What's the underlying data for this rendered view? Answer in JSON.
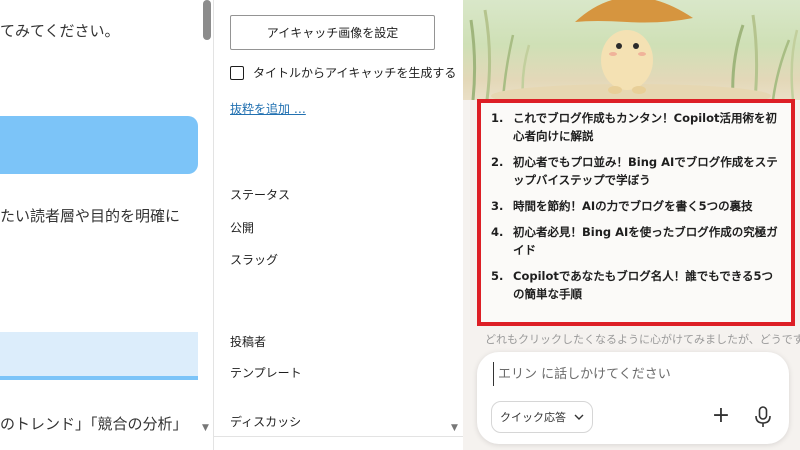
{
  "editor": {
    "line1": "てみてください。",
    "line2": "たい読者層や目的を明確に",
    "line3": "のトレンド」「競合の分析」"
  },
  "settings": {
    "featured_image_button": "アイキャッチ画像を設定",
    "generate_from_title_label": "タイトルからアイキャッチを生成する",
    "add_excerpt_link": "抜粋を追加 …",
    "status_label": "ステータス",
    "visibility_label": "公開",
    "slug_label": "スラッグ",
    "author_label": "投稿者",
    "template_label": "テンプレート",
    "discussion_label": "ディスカッション"
  },
  "copilot": {
    "answers": [
      {
        "num": "1.",
        "text": "これでブログ作成もカンタン！Copilot活用術を初心者向けに解説"
      },
      {
        "num": "2.",
        "text": "初心者でもプロ並み！Bing AIでブログ作成をステップバイステップで学ぼう"
      },
      {
        "num": "3.",
        "text": "時間を節約！AIの力でブログを書く5つの裏技"
      },
      {
        "num": "4.",
        "text": "初心者必見！Bing AIを使ったブログ作成の究極ガイド"
      },
      {
        "num": "5.",
        "text": "Copilotであなたもブログ名人！誰でもできる5つの簡単な手順"
      }
    ],
    "trailing_text": "どれもクリックしたくなるように心がけてみましたが、どうです",
    "input_placeholder": "エリン に話しかけてください",
    "mode_label": "クイック応答",
    "plus_symbol": "+",
    "highlight_color": "#dd1f26"
  }
}
